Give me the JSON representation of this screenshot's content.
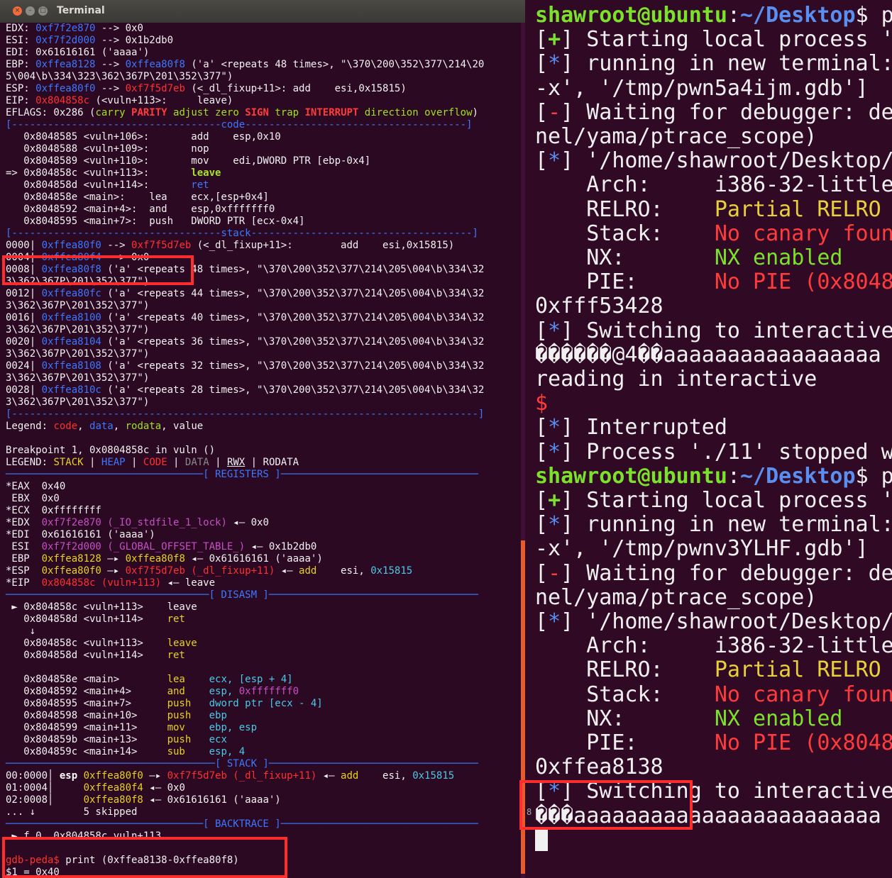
{
  "window": {
    "title": "Terminal",
    "close_glyph": "×",
    "min_glyph": "–",
    "max_glyph": "□"
  },
  "left_lines": [
    [
      [
        "EDX: ",
        ""
      ],
      [
        "0xf7f2e870",
        "c-blue"
      ],
      [
        " --> 0x0",
        ""
      ]
    ],
    [
      [
        "ESI: ",
        ""
      ],
      [
        "0xf7f2d000",
        "c-blue"
      ],
      [
        " --> 0x1b2db0",
        ""
      ]
    ],
    [
      [
        "EDI: 0x61616161 ('aaaa')",
        ""
      ]
    ],
    [
      [
        "EBP: ",
        ""
      ],
      [
        "0xffea8128",
        "c-blue"
      ],
      [
        " --> ",
        ""
      ],
      [
        "0xffea80f8",
        "c-blue"
      ],
      [
        " ('a' <repeats 48 times>, \"\\370\\200\\352\\377\\214\\20",
        ""
      ]
    ],
    [
      [
        "5\\004\\b\\334\\323\\362\\367P\\201\\352\\377\")",
        ""
      ]
    ],
    [
      [
        "ESP: ",
        ""
      ],
      [
        "0xffea80f0",
        "c-blue"
      ],
      [
        " --> ",
        ""
      ],
      [
        "0xf7f5d7eb",
        "c-red"
      ],
      [
        " (<_dl_fixup+11>: add    esi,0x15815)",
        ""
      ]
    ],
    [
      [
        "EIP: ",
        ""
      ],
      [
        "0x804858c",
        "c-red"
      ],
      [
        " (<vuln+113>:     leave)",
        ""
      ]
    ],
    [
      [
        "EFLAGS: 0x286 (",
        ""
      ],
      [
        "carry ",
        "c-grn"
      ],
      [
        "PARITY ",
        "c-redb"
      ],
      [
        "adjust zero ",
        "c-grn"
      ],
      [
        "SIGN ",
        "c-redb"
      ],
      [
        "trap ",
        "c-grn"
      ],
      [
        "INTERRUPT ",
        "c-redb"
      ],
      [
        "direction overflow",
        "c-grn"
      ],
      [
        ")",
        ""
      ]
    ],
    [
      [
        "[-----------------------------------code-------------------------------------]",
        "c-blue"
      ]
    ],
    [
      [
        "   0x8048585 <vuln+106>:       add    esp,0x10",
        ""
      ]
    ],
    [
      [
        "   0x8048588 <vuln+109>:       nop",
        ""
      ]
    ],
    [
      [
        "   0x8048589 <vuln+110>:       mov    edi,DWORD PTR [ebp-0x4]",
        ""
      ]
    ],
    [
      [
        "=> 0x804858c <vuln+113>:       ",
        ""
      ],
      [
        "leave",
        "c-grnb"
      ]
    ],
    [
      [
        "   0x804858d <vuln+114>:       ",
        ""
      ],
      [
        "ret",
        "c-blue"
      ]
    ],
    [
      [
        "   0x804858e <main>:    lea    ecx,[esp+0x4]",
        ""
      ]
    ],
    [
      [
        "   0x8048592 <main+4>:  and    esp,0xfffffff0",
        ""
      ]
    ],
    [
      [
        "   0x8048595 <main+7>:  push   DWORD PTR [ecx-0x4]",
        ""
      ]
    ],
    [
      [
        "[-----------------------------------stack-------------------------------------]",
        "c-blue"
      ]
    ],
    [
      [
        "0000| ",
        ""
      ],
      [
        "0xffea80f0",
        "c-blue"
      ],
      [
        " --> ",
        ""
      ],
      [
        "0xf7f5d7eb",
        "c-red"
      ],
      [
        " (<_dl_fixup+11>:        add    esi,0x15815)",
        ""
      ]
    ],
    [
      [
        "0004| ",
        ""
      ],
      [
        "0xffea80f4",
        "c-blue"
      ],
      [
        " --> 0x0",
        ""
      ]
    ],
    [
      [
        "0008| ",
        ""
      ],
      [
        "0xffea80f8",
        "c-blue"
      ],
      [
        " ('a' <repeats 48 times>, \"\\370\\200\\352\\377\\214\\205\\004\\b\\334\\32",
        ""
      ]
    ],
    [
      [
        "3\\362\\367P\\201\\352\\377\")",
        ""
      ]
    ],
    [
      [
        "0012| ",
        ""
      ],
      [
        "0xffea80fc",
        "c-blue"
      ],
      [
        " ('a' <repeats 44 times>, \"\\370\\200\\352\\377\\214\\205\\004\\b\\334\\32",
        ""
      ]
    ],
    [
      [
        "3\\362\\367P\\201\\352\\377\")",
        ""
      ]
    ],
    [
      [
        "0016| ",
        ""
      ],
      [
        "0xffea8100",
        "c-blue"
      ],
      [
        " ('a' <repeats 40 times>, \"\\370\\200\\352\\377\\214\\205\\004\\b\\334\\32",
        ""
      ]
    ],
    [
      [
        "3\\362\\367P\\201\\352\\377\")",
        ""
      ]
    ],
    [
      [
        "0020| ",
        ""
      ],
      [
        "0xffea8104",
        "c-blue"
      ],
      [
        " ('a' <repeats 36 times>, \"\\370\\200\\352\\377\\214\\205\\004\\b\\334\\32",
        ""
      ]
    ],
    [
      [
        "3\\362\\367P\\201\\352\\377\")",
        ""
      ]
    ],
    [
      [
        "0024| ",
        ""
      ],
      [
        "0xffea8108",
        "c-blue"
      ],
      [
        " ('a' <repeats 32 times>, \"\\370\\200\\352\\377\\214\\205\\004\\b\\334\\32",
        ""
      ]
    ],
    [
      [
        "3\\362\\367P\\201\\352\\377\")",
        ""
      ]
    ],
    [
      [
        "0028| ",
        ""
      ],
      [
        "0xffea810c",
        "c-blue"
      ],
      [
        " ('a' <repeats 28 times>, \"\\370\\200\\352\\377\\214\\205\\004\\b\\334\\32",
        ""
      ]
    ],
    [
      [
        "3\\362\\367P\\201\\352\\377\")",
        ""
      ]
    ],
    [
      [
        "[------------------------------------------------------------------------------]",
        "c-blue"
      ]
    ],
    [
      [
        "Legend: ",
        ""
      ],
      [
        "code",
        "c-red"
      ],
      [
        ", ",
        ""
      ],
      [
        "data",
        "c-blue"
      ],
      [
        ", ",
        ""
      ],
      [
        "rodata",
        "c-grn"
      ],
      [
        ", value",
        ""
      ]
    ],
    [
      [
        "",
        ""
      ]
    ],
    [
      [
        "Breakpoint 1, 0x0804858c in vuln ()",
        ""
      ]
    ],
    [
      [
        "LEGEND: ",
        ""
      ],
      [
        "STACK",
        "c-yel"
      ],
      [
        " | ",
        ""
      ],
      [
        "HEAP",
        "c-blue"
      ],
      [
        " | ",
        ""
      ],
      [
        "CODE",
        "c-red"
      ],
      [
        " | ",
        ""
      ],
      [
        "DATA",
        "c-dim"
      ],
      [
        " | ",
        ""
      ],
      [
        "RWX",
        "ul"
      ],
      [
        " | RODATA",
        ""
      ]
    ],
    [
      [
        "─────────────────────────────────[ REGISTERS ]─────────────────────────────────",
        "c-blue"
      ]
    ],
    [
      [
        "*EAX  0x40",
        ""
      ]
    ],
    [
      [
        " EBX  0x0",
        ""
      ]
    ],
    [
      [
        "*ECX  0xffffffff",
        ""
      ]
    ],
    [
      [
        "*EDX  ",
        ""
      ],
      [
        "0xf7f2e870 (_IO_stdfile_1_lock)",
        "c-mag"
      ],
      [
        " ◂— 0x0",
        ""
      ]
    ],
    [
      [
        "*EDI  0x61616161 ('aaaa')",
        ""
      ]
    ],
    [
      [
        " ESI  ",
        ""
      ],
      [
        "0xf7f2d000 (_GLOBAL_OFFSET_TABLE_)",
        "c-mag"
      ],
      [
        " ◂— 0x1b2db0",
        ""
      ]
    ],
    [
      [
        " EBP  ",
        ""
      ],
      [
        "0xffea8128",
        "c-yel"
      ],
      [
        " —▸ ",
        ""
      ],
      [
        "0xffea80f8",
        "c-yel"
      ],
      [
        " ◂— 0x61616161 ('aaaa')",
        ""
      ]
    ],
    [
      [
        "*ESP  ",
        ""
      ],
      [
        "0xffea80f0",
        "c-yel"
      ],
      [
        " —▸ ",
        ""
      ],
      [
        "0xf7f5d7eb (_dl_fixup+11)",
        "c-red"
      ],
      [
        " ◂— ",
        ""
      ],
      [
        "add",
        "c-yel"
      ],
      [
        "    esi, ",
        ""
      ],
      [
        "0x15815",
        "c-cyan"
      ]
    ],
    [
      [
        "*EIP  ",
        ""
      ],
      [
        "0x804858c (vuln+113)",
        "c-red"
      ],
      [
        " ◂— leave",
        ""
      ]
    ],
    [
      [
        "──────────────────────────────────[ DISASM ]───────────────────────────────────",
        "c-blue"
      ]
    ],
    [
      [
        " ► 0x804858c <vuln+113>    leave",
        ""
      ]
    ],
    [
      [
        "   0x804858d <vuln+114>    ",
        ""
      ],
      [
        "ret",
        "c-yel"
      ]
    ],
    [
      [
        "    ↓",
        ""
      ]
    ],
    [
      [
        "   0x804858c <vuln+113>    ",
        ""
      ],
      [
        "leave",
        "c-yel"
      ]
    ],
    [
      [
        "   0x804858d <vuln+114>    ",
        ""
      ],
      [
        "ret",
        "c-yel"
      ]
    ],
    [
      [
        "",
        ""
      ]
    ],
    [
      [
        "   0x804858e <main>        ",
        ""
      ],
      [
        "lea    ",
        "c-yel"
      ],
      [
        "ecx, [esp + 4]",
        "c-cyan"
      ]
    ],
    [
      [
        "   0x8048592 <main+4>      ",
        ""
      ],
      [
        "and    ",
        "c-yel"
      ],
      [
        "esp, ",
        "c-cyan"
      ],
      [
        "0xfffffff0",
        "c-mag"
      ]
    ],
    [
      [
        "   0x8048595 <main+7>      ",
        ""
      ],
      [
        "push   ",
        "c-yel"
      ],
      [
        "dword ptr [ecx - 4]",
        "c-cyan"
      ]
    ],
    [
      [
        "   0x8048598 <main+10>     ",
        ""
      ],
      [
        "push   ",
        "c-yel"
      ],
      [
        "ebp",
        "c-cyan"
      ]
    ],
    [
      [
        "   0x8048599 <main+11>     ",
        ""
      ],
      [
        "mov    ",
        "c-yel"
      ],
      [
        "ebp, esp",
        "c-cyan"
      ]
    ],
    [
      [
        "   0x804859b <main+13>     ",
        ""
      ],
      [
        "push   ",
        "c-yel"
      ],
      [
        "ecx",
        "c-cyan"
      ]
    ],
    [
      [
        "   0x804859c <main+14>     ",
        ""
      ],
      [
        "sub    ",
        "c-yel"
      ],
      [
        "esp, 4",
        "c-cyan"
      ]
    ],
    [
      [
        "───────────────────────────────────[ STACK ]───────────────────────────────────",
        "c-blue"
      ]
    ],
    [
      [
        "00:0000│ ",
        ""
      ],
      [
        "esp ",
        "c-wb"
      ],
      [
        "0xffea80f0",
        "c-yel"
      ],
      [
        " —▸ ",
        ""
      ],
      [
        "0xf7f5d7eb (_dl_fixup+11)",
        "c-red"
      ],
      [
        " ◂— ",
        ""
      ],
      [
        "add",
        "c-yel"
      ],
      [
        "    esi, ",
        ""
      ],
      [
        "0x15815",
        "c-cyan"
      ]
    ],
    [
      [
        "01:0004│     ",
        ""
      ],
      [
        "0xffea80f4",
        "c-yel"
      ],
      [
        " ◂— 0x0",
        ""
      ]
    ],
    [
      [
        "02:0008│     ",
        ""
      ],
      [
        "0xffea80f8",
        "c-yel"
      ],
      [
        " ◂— 0x61616161 ('aaaa')",
        ""
      ]
    ],
    [
      [
        "... ↓        5 skipped",
        ""
      ]
    ],
    [
      [
        "─────────────────────────────────[ BACKTRACE ]─────────────────────────────────",
        "c-blue"
      ]
    ],
    [
      [
        " ► f 0  0x804858c vuln+113",
        ""
      ]
    ],
    [
      [
        "",
        ""
      ]
    ],
    [
      [
        "gdb-peda$ ",
        "c-red"
      ],
      [
        "print (0xffea8138-0xffea80f8)",
        ""
      ]
    ],
    [
      [
        "$1 = 0x40",
        ""
      ]
    ]
  ],
  "right_lines": [
    [
      [
        "shawroot@ubuntu",
        "r-grn"
      ],
      [
        ":",
        ""
      ],
      [
        "~/Desktop",
        "r-blue"
      ],
      [
        "$ p",
        ""
      ]
    ],
    [
      [
        "[",
        ""
      ],
      [
        "+",
        "r-grn"
      ],
      [
        "] Starting local process '",
        ""
      ]
    ],
    [
      [
        "[",
        ""
      ],
      [
        "*",
        "r-bg"
      ],
      [
        "] running in new terminal:",
        ""
      ]
    ],
    [
      [
        "-x', '/tmp/pwn5a4ijm.gdb']",
        ""
      ]
    ],
    [
      [
        "[",
        ""
      ],
      [
        "-",
        "r-red"
      ],
      [
        "] Waiting for debugger: de",
        ""
      ]
    ],
    [
      [
        "nel/yama/ptrace_scope)",
        ""
      ]
    ],
    [
      [
        "[",
        ""
      ],
      [
        "*",
        "r-bg"
      ],
      [
        "] '/home/shawroot/Desktop/",
        ""
      ]
    ],
    [
      [
        "    Arch:     i386-32-little",
        ""
      ]
    ],
    [
      [
        "    RELRO:    ",
        ""
      ],
      [
        "Partial RELRO",
        "r-ylw"
      ]
    ],
    [
      [
        "    Stack:    ",
        ""
      ],
      [
        "No canary foun",
        "r-red"
      ]
    ],
    [
      [
        "    NX:       ",
        ""
      ],
      [
        "NX enabled",
        "r-gr2"
      ]
    ],
    [
      [
        "    PIE:      ",
        ""
      ],
      [
        "No PIE (0x8048",
        "r-red"
      ]
    ],
    [
      [
        "0xfff53428",
        ""
      ]
    ],
    [
      [
        "[",
        ""
      ],
      [
        "*",
        "r-bg"
      ],
      [
        "] Switching to interactive",
        ""
      ]
    ],
    [
      [
        "������@4��aaaaaaaaaaaaaaaaa",
        ""
      ]
    ],
    [
      [
        "reading in interactive",
        ""
      ]
    ],
    [
      [
        "$",
        "r-red"
      ]
    ],
    [
      [
        "[",
        ""
      ],
      [
        "*",
        "r-bg"
      ],
      [
        "] Interrupted",
        ""
      ]
    ],
    [
      [
        "[",
        ""
      ],
      [
        "*",
        "r-bg"
      ],
      [
        "] Process './11' stopped w",
        ""
      ]
    ],
    [
      [
        "shawroot@ubuntu",
        "r-grn"
      ],
      [
        ":",
        ""
      ],
      [
        "~/Desktop",
        "r-blue"
      ],
      [
        "$ p",
        ""
      ]
    ],
    [
      [
        "[",
        ""
      ],
      [
        "+",
        "r-grn"
      ],
      [
        "] Starting local process '",
        ""
      ]
    ],
    [
      [
        "[",
        ""
      ],
      [
        "*",
        "r-bg"
      ],
      [
        "] running in new terminal:",
        ""
      ]
    ],
    [
      [
        "-x', '/tmp/pwnv3YLHF.gdb']",
        ""
      ]
    ],
    [
      [
        "[",
        ""
      ],
      [
        "-",
        "r-red"
      ],
      [
        "] Waiting for debugger: de",
        ""
      ]
    ],
    [
      [
        "nel/yama/ptrace_scope)",
        ""
      ]
    ],
    [
      [
        "[",
        ""
      ],
      [
        "*",
        "r-bg"
      ],
      [
        "] '/home/shawroot/Desktop/",
        ""
      ]
    ],
    [
      [
        "    Arch:     i386-32-little",
        ""
      ]
    ],
    [
      [
        "    RELRO:    ",
        ""
      ],
      [
        "Partial RELRO",
        "r-ylw"
      ]
    ],
    [
      [
        "    Stack:    ",
        ""
      ],
      [
        "No canary foun",
        "r-red"
      ]
    ],
    [
      [
        "    NX:       ",
        ""
      ],
      [
        "NX enabled",
        "r-gr2"
      ]
    ],
    [
      [
        "    PIE:      ",
        ""
      ],
      [
        "No PIE (0x8048",
        "r-red"
      ]
    ],
    [
      [
        "0xffea8138",
        ""
      ]
    ],
    [
      [
        "[",
        ""
      ],
      [
        "*",
        "r-bg"
      ],
      [
        "] Switching to interactive",
        ""
      ]
    ],
    [
      [
        "���aaaaaaaaaaaaaaaaaaaaaaaa",
        ""
      ]
    ]
  ],
  "gutter_label": "8",
  "colors": {
    "terminal_bg": "#300a24",
    "highlight_box": "#ff2d2d"
  }
}
